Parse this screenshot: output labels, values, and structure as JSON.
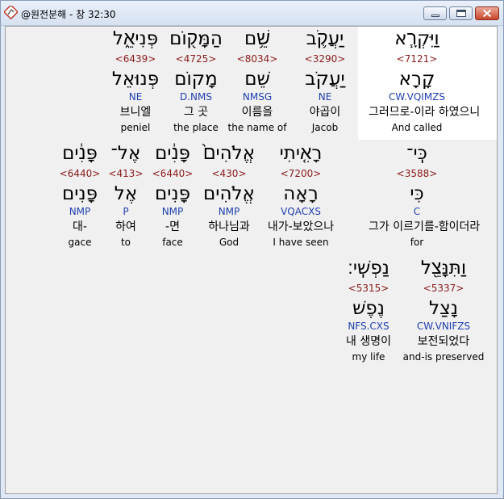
{
  "window": {
    "title": "@원전분해 - 창 32:30"
  },
  "rows": [
    [
      {
        "hebrew": "פְּנִיאֵ֑ל",
        "strong": "<6439>",
        "lemma": "פְּנוּאֵל",
        "morph": "NE",
        "korean": "브니엘",
        "english": "peniel"
      },
      {
        "hebrew": "הַמָּק֖וֹם",
        "strong": "<4725>",
        "lemma": "מָקוֹם",
        "morph": "D.NMS",
        "korean": "그 곳",
        "english": "the place"
      },
      {
        "hebrew": "שֵׁ֥ם",
        "strong": "<8034>",
        "lemma": "שֵׁם",
        "morph": "NMSG",
        "korean": "이름을",
        "english": "the name of"
      },
      {
        "hebrew": "יַעֲקֹ֛ב",
        "strong": "<3290>",
        "lemma": "יַעֲקֹב",
        "morph": "NE",
        "korean": "야곱이",
        "english": "Jacob"
      },
      {
        "hebrew": "וַיִּקְרָ֧א",
        "strong": "<7121>",
        "lemma": "קָרָא",
        "morph": "CW.VQIMZS",
        "korean": "그러므로-이라 하였으니",
        "english": "And called"
      }
    ],
    [
      {
        "hebrew": "פָּנִ֔ים",
        "strong": "<6440>",
        "lemma": "פָּנִים",
        "morph": "NMP",
        "korean": "대-",
        "english": "gace"
      },
      {
        "hebrew": "אֶל־",
        "strong": "<413>",
        "lemma": "אֶל",
        "morph": "P",
        "korean": "하여",
        "english": "to"
      },
      {
        "hebrew": "פָּנִ֔ים",
        "strong": "<6440>",
        "lemma": "פָּנִים",
        "morph": "NMP",
        "korean": "-면",
        "english": "face"
      },
      {
        "hebrew": "אֱלֹהִים֙",
        "strong": "<430>",
        "lemma": "אֱלֹהִים",
        "morph": "NMP",
        "korean": "하나님과",
        "english": "God"
      },
      {
        "hebrew": "רָאִ֤יתִי",
        "strong": "<7200>",
        "lemma": "רָאָה",
        "morph": "VQACXS",
        "korean": "내가-보았으나",
        "english": "I have seen"
      },
      {
        "hebrew": "כִּֽי־",
        "strong": "<3588>",
        "lemma": "כִּי",
        "morph": "C",
        "korean": "그가 이르기를-함이더라",
        "english": "for"
      }
    ],
    [
      {
        "hebrew": "נַפְשִֽׁי׃",
        "strong": "<5315>",
        "lemma": "נֶפֶשׁ",
        "morph": "NFS.CXS",
        "korean": "내 생명이",
        "english": "my life"
      },
      {
        "hebrew": "וַתִּנָּצֵ֖ל",
        "strong": "<5337>",
        "lemma": "נָצַל",
        "morph": "CW.VNIFZS",
        "korean": "보전되었다",
        "english": "and-is preserved"
      }
    ]
  ],
  "colors": {
    "strong": "#8b1a1a",
    "morph": "#1f3fae",
    "highlight": "#ffffff"
  }
}
